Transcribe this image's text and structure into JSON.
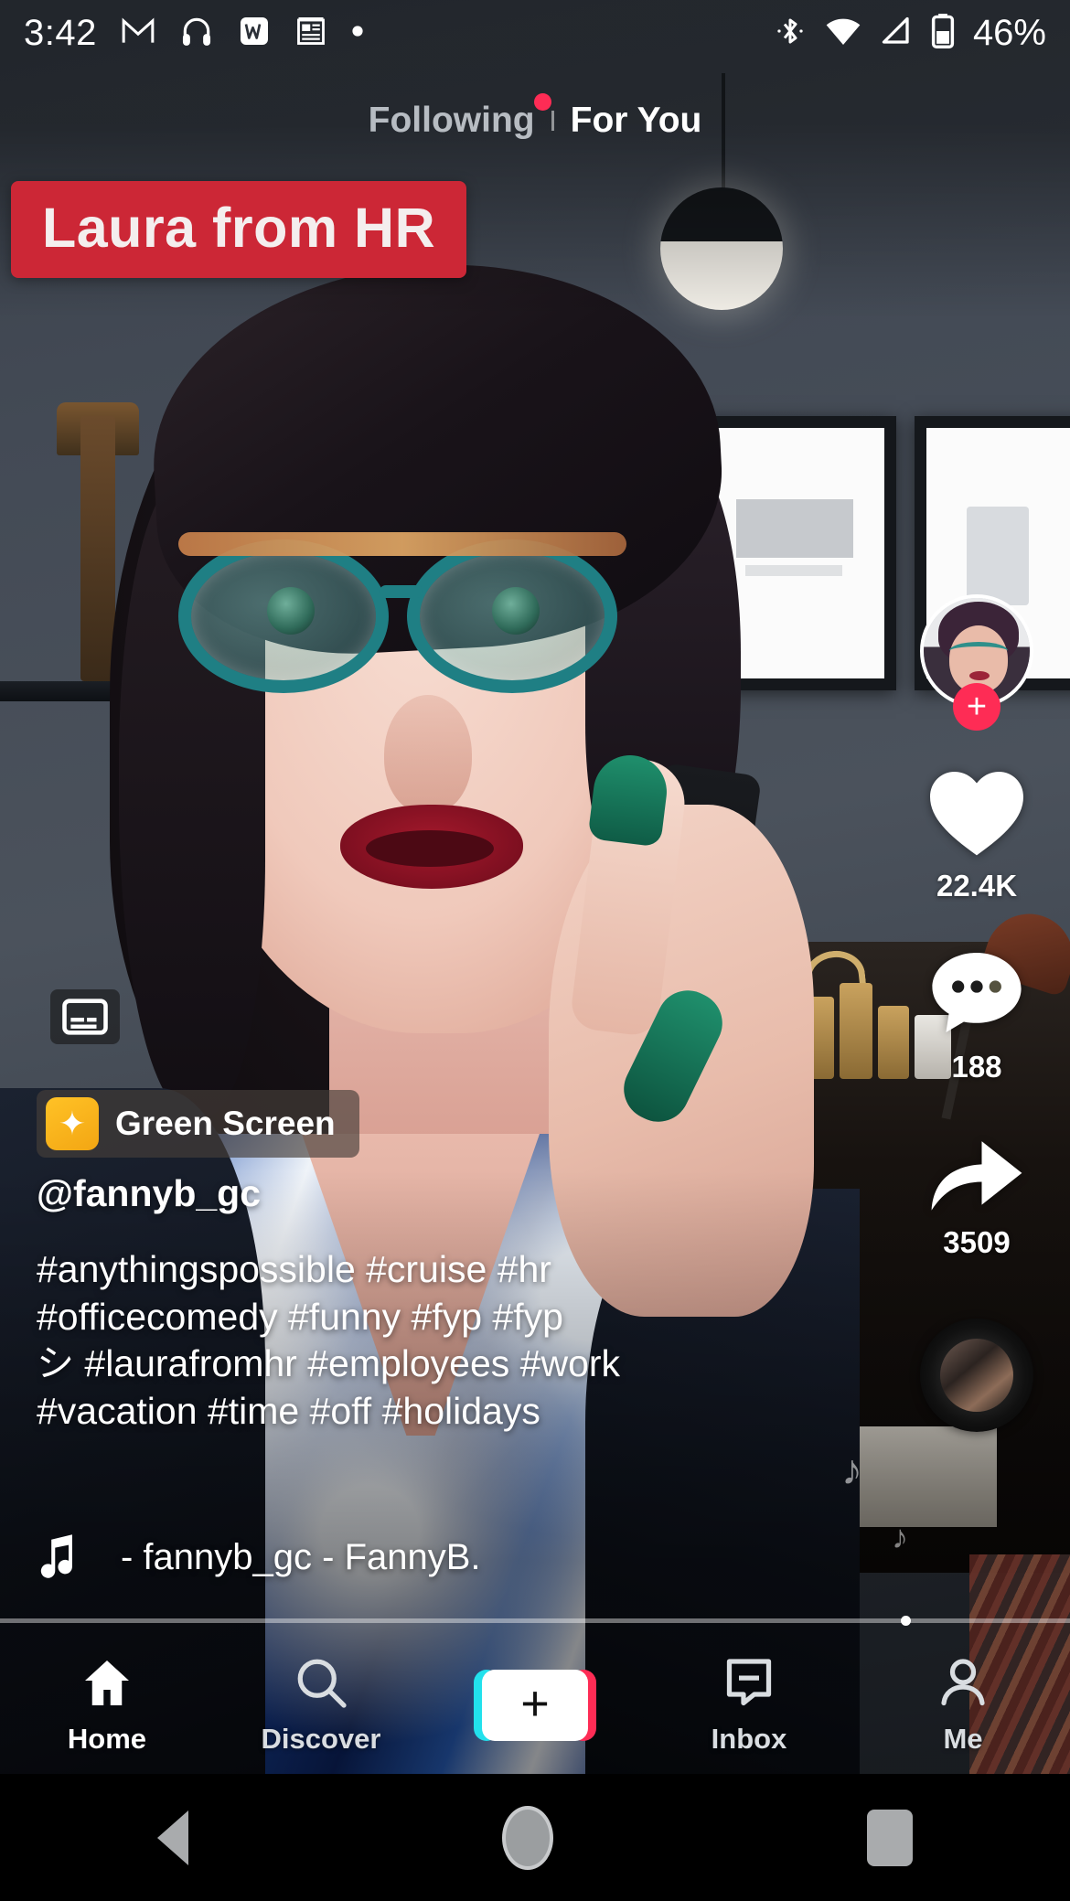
{
  "status_bar": {
    "time": "3:42",
    "battery": "46%",
    "left_icons": [
      "gmail-icon",
      "headphones-icon",
      "word-icon",
      "news-icon",
      "dot-icon"
    ],
    "right_icons": [
      "bluetooth-icon",
      "wifi-icon",
      "cellular-icon",
      "battery-icon"
    ]
  },
  "top_nav": {
    "following_label": "Following",
    "foryou_label": "For You",
    "active": "For You",
    "following_has_badge": true
  },
  "video": {
    "title_banner": "Laura from HR",
    "banner_color": "#cc2736",
    "captions_icon": "closed-captions-icon",
    "effect_badge": {
      "label": "Green Screen",
      "icon": "magic-wand-star-icon",
      "icon_color": "#f5ae18"
    }
  },
  "post": {
    "handle": "@fannyb_gc",
    "caption_lines": [
      "#anythingspossible #cruise #hr",
      "#officecomedy #funny #fyp #fyp",
      "シ #laurafromhr #employees #work",
      "#vacation #time #off #holidays"
    ],
    "music_icon": "music-note-icon",
    "music_title": "- fannyb_gc - FannyB."
  },
  "actions": {
    "avatar_name": "creator-avatar",
    "follow_label": "+",
    "like": {
      "icon": "heart-icon",
      "count": "22.4K"
    },
    "comment": {
      "icon": "comment-bubble-icon",
      "count": "188"
    },
    "share": {
      "icon": "share-arrow-icon",
      "count": "3509"
    },
    "disc": "music-disc-icon"
  },
  "tabbar": {
    "items": [
      {
        "label": "Home",
        "icon": "home-icon",
        "active": true
      },
      {
        "label": "Discover",
        "icon": "search-icon",
        "active": false
      },
      {
        "label": "",
        "icon": "create-plus-icon",
        "active": false
      },
      {
        "label": "Inbox",
        "icon": "inbox-message-icon",
        "active": false
      },
      {
        "label": "Me",
        "icon": "person-icon",
        "active": false
      }
    ]
  },
  "android_nav": {
    "back": "back-triangle-icon",
    "home": "home-circle-icon",
    "recents": "recents-square-icon"
  },
  "colors": {
    "accent_pink": "#fe2c55",
    "accent_cyan": "#22e1ec",
    "banner_red": "#cc2736"
  }
}
